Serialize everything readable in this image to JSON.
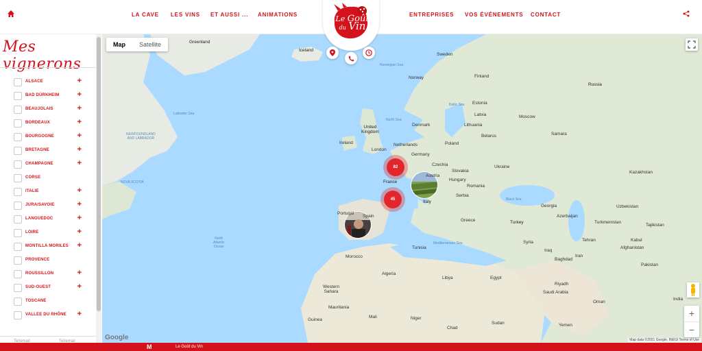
{
  "header": {
    "nav_left": [
      "LA CAVE",
      "LES VINS",
      "ET AUSSI ...",
      "ANIMATIONS"
    ],
    "nav_right": [
      "ENTREPRISES",
      "VOS ÉVÉNEMENTS",
      "CONTACT"
    ],
    "logo": {
      "line1": "Le",
      "line2": "Goût",
      "line3": "du",
      "line4": "Vin"
    },
    "logo_icons": [
      "location-pin-icon",
      "phone-icon",
      "clock-icon"
    ],
    "accent_color": "#d4121b"
  },
  "sidebar": {
    "title": "Mes vignerons",
    "regions": [
      {
        "label": "ALSACE",
        "expandable": true
      },
      {
        "label": "BAD DÜRKHEIM",
        "expandable": true
      },
      {
        "label": "BEAUJOLAIS",
        "expandable": true
      },
      {
        "label": "BORDEAUX",
        "expandable": true
      },
      {
        "label": "BOURGOGNE",
        "expandable": true
      },
      {
        "label": "BRETAGNE",
        "expandable": true
      },
      {
        "label": "CHAMPAGNE",
        "expandable": true
      },
      {
        "label": "CORSE",
        "expandable": false
      },
      {
        "label": "ITALIE",
        "expandable": true
      },
      {
        "label": "JURA/SAVOIE",
        "expandable": true
      },
      {
        "label": "LANGUEDOC",
        "expandable": true
      },
      {
        "label": "LOIRE",
        "expandable": true
      },
      {
        "label": "MONTILLA MORILES",
        "expandable": true
      },
      {
        "label": "PROVENCE",
        "expandable": false
      },
      {
        "label": "ROUSSILLON",
        "expandable": true
      },
      {
        "label": "SUD-OUEST",
        "expandable": true
      },
      {
        "label": "TOSCANE",
        "expandable": false
      },
      {
        "label": "VALLEE DU RHÔNE",
        "expandable": true
      }
    ],
    "footer_tabs": [
      "Tel/email",
      "Tel/email"
    ]
  },
  "map": {
    "type_buttons": [
      "Map",
      "Satellite"
    ],
    "active_type": "Map",
    "zoom_in": "+",
    "zoom_out": "−",
    "google_label": "Google",
    "attribution": "Map data ©2021 Google, INEGI   Terms of Use",
    "clusters": [
      "82",
      "45"
    ],
    "labels": {
      "greenland": "Greenland",
      "iceland": "Iceland",
      "sweden": "Sweden",
      "finland": "Finland",
      "norway": "Norway",
      "estonia": "Estonia",
      "latvia": "Latvia",
      "lithuania": "Lithuania",
      "denmark": "Denmark",
      "uk": "United\nKingdom",
      "ireland": "Ireland",
      "netherlands": "Netherlands",
      "london": "London",
      "germany": "Germany",
      "poland": "Poland",
      "belarus": "Belarus",
      "moscow": "Moscow",
      "russia": "Russia",
      "ukraine": "Ukraine",
      "kazakhstan": "Kazakhstan",
      "france": "France",
      "czechia": "Czechia",
      "slovakia": "Slovakia",
      "hungary": "Hungary",
      "austria": "Austria",
      "romania": "Romania",
      "serbia": "Serbia",
      "italy": "Italy",
      "portugal": "Portugal",
      "spain": "Spain",
      "greece": "Greece",
      "turkey": "Turkey",
      "georgia": "Georgia",
      "azerbaijan": "Azerbaijan",
      "uzbekistan": "Uzbekistan",
      "turkmenistan": "Turkmenistan",
      "tajikistan": "Tajikistan",
      "afghanistan": "Afghanistan",
      "pakistan": "Pakistan",
      "iran": "Iran",
      "iraq": "Iraq",
      "syria": "Syria",
      "saudi": "Saudi Arabia",
      "egypt": "Egypt",
      "libya": "Libya",
      "algeria": "Algeria",
      "morocco": "Morocco",
      "tunisia": "Tunisia",
      "mauritania": "Mauritania",
      "mali": "Mali",
      "niger": "Niger",
      "chad": "Chad",
      "sudan": "Sudan",
      "yemen": "Yemen",
      "oman": "Oman",
      "india": "India",
      "western_sahara": "Western\nSahara",
      "north_sea": "North Sea",
      "baltic": "Baltic Sea",
      "black_sea": "Black Sea",
      "north_atlantic": "North\nAtlantic\nOcean",
      "labrador_sea": "Labrador Sea",
      "med_sea": "Mediterranean Sea",
      "norwegian_sea": "Norwegian Sea",
      "newfoundland": "NEWFOUNDLAND\nAND LABRADOR",
      "nova": "NOVA SCOTIA",
      "samara": "Samara",
      "kabul": "Kabul",
      "baghdad": "Baghdad",
      "tehran": "Tehran",
      "riyadh": "Riyadh",
      "guinea": "Guinea"
    }
  },
  "footer": {
    "text": "Le Goût du Vin"
  }
}
